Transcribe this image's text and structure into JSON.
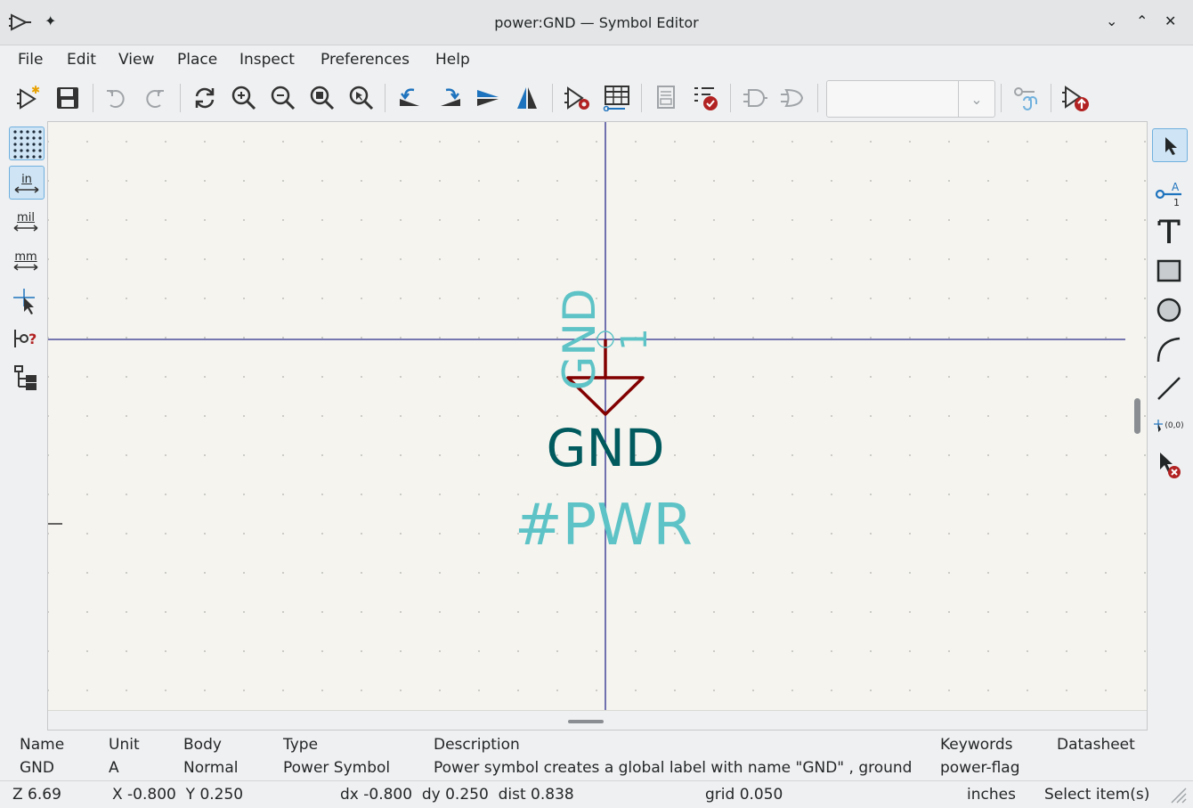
{
  "window": {
    "title": "power:GND — Symbol Editor",
    "controls": [
      "⌄",
      "⌃",
      "✕"
    ]
  },
  "menu": [
    "File",
    "Edit",
    "View",
    "Place",
    "Inspect",
    "Preferences",
    "Help"
  ],
  "toolbar": {
    "icons": [
      "new-symbol-icon",
      "save-icon",
      "undo-icon",
      "redo-icon",
      "refresh-icon",
      "zoom-in-icon",
      "zoom-out-icon",
      "zoom-fit-icon",
      "zoom-objects-icon",
      "rotate-ccw-icon",
      "rotate-cw-icon",
      "mirror-v-icon",
      "mirror-h-icon",
      "symbol-properties-icon",
      "pin-table-icon",
      "datasheet-icon",
      "check-icon",
      "body-style-1-icon",
      "body-style-2-icon",
      "unit-select-combo",
      "show-pin-electrical-type-icon",
      "add-symbol-to-schematic-icon"
    ],
    "unit_select_value": ""
  },
  "left_tools": {
    "unit_in": "in",
    "unit_mil": "mil",
    "unit_mm": "mm"
  },
  "right_tools": {
    "origin_label": "(0,0)"
  },
  "canvas": {
    "pin_name": "GND",
    "pin_number": "1",
    "value_label": "GND",
    "reference_label": "#PWR"
  },
  "properties": {
    "headers": [
      "Name",
      "Unit",
      "Body",
      "Type",
      "Description",
      "Keywords",
      "Datasheet"
    ],
    "values": [
      "GND",
      "A",
      "Normal",
      "Power Symbol",
      "Power symbol creates a global label with name \"GND\" , ground",
      "power-flag",
      ""
    ]
  },
  "status": {
    "zoom": "Z 6.69",
    "xy": "X -0.800  Y 0.250",
    "delta": "dx -0.800  dy 0.250  dist 0.838",
    "grid": "grid 0.050",
    "units": "inches",
    "mode": "Select item(s)"
  },
  "colors": {
    "canvas_bg": "#f5f4ef",
    "crosshair": "#2b2b8c",
    "symbol_body": "#820000",
    "field_text": "#5ec3c6",
    "value_text": "#005a5e",
    "accent": "#3daee9"
  }
}
